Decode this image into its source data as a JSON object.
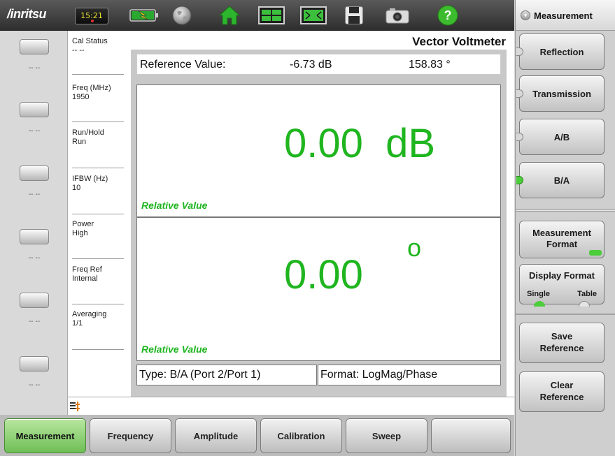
{
  "app": {
    "logo_text": "/inritsu",
    "clock": "15:21",
    "screen_title": "Vector Voltmeter"
  },
  "toolbar": {
    "icons": [
      "battery-charging-icon",
      "globe-icon",
      "home-icon",
      "layout-icon",
      "fullscreen-icon",
      "save-icon",
      "camera-icon",
      "help-icon"
    ],
    "help_glyph": "?"
  },
  "left_keys": {
    "items": [
      {
        "label": "-- --"
      },
      {
        "label": "-- --"
      },
      {
        "label": "-- --"
      },
      {
        "label": "-- --"
      },
      {
        "label": "-- --"
      },
      {
        "label": "-- --"
      }
    ]
  },
  "params": [
    {
      "name": "Cal Status",
      "value": "-- --"
    },
    {
      "name": "Freq (MHz)",
      "value": "1950"
    },
    {
      "name": "Run/Hold",
      "value": "Run"
    },
    {
      "name": "IFBW (Hz)",
      "value": "10"
    },
    {
      "name": "Power",
      "value": "High"
    },
    {
      "name": "Freq Ref",
      "value": "Internal"
    },
    {
      "name": "Averaging",
      "value": "1/1"
    }
  ],
  "reference": {
    "label": "Reference Value:",
    "magnitude": "-6.73 dB",
    "phase": "158.83 °"
  },
  "panels": {
    "magnitude": {
      "value": "0.00  dB",
      "caption": "Relative Value"
    },
    "phase": {
      "value": "0.00",
      "unit": "o",
      "caption": "Relative Value"
    }
  },
  "footer_info": {
    "type": "Type: B/A (Port 2/Port 1)",
    "format": "Format: LogMag/Phase"
  },
  "bottom_menu": {
    "tabs": [
      "Measurement",
      "Frequency",
      "Amplitude",
      "Calibration",
      "Sweep",
      ""
    ],
    "active": "Measurement"
  },
  "right_menu": {
    "title": "Measurement",
    "buttons": {
      "reflection": "Reflection",
      "transmission": "Transmission",
      "a_b": "A/B",
      "b_a": "B/A",
      "measurement_format_line1": "Measurement",
      "measurement_format_line2": "Format",
      "display_format": "Display Format",
      "display_single": "Single",
      "display_table": "Table",
      "save_reference_line1": "Save",
      "save_reference_line2": "Reference",
      "clear_reference_line1": "Clear",
      "clear_reference_line2": "Reference"
    },
    "selected": "B/A",
    "display_format_selected": "Single"
  },
  "colors": {
    "value_green": "#1fb51f",
    "active_tab": "#8fd375",
    "lamp_on": "#4ccd3a"
  }
}
